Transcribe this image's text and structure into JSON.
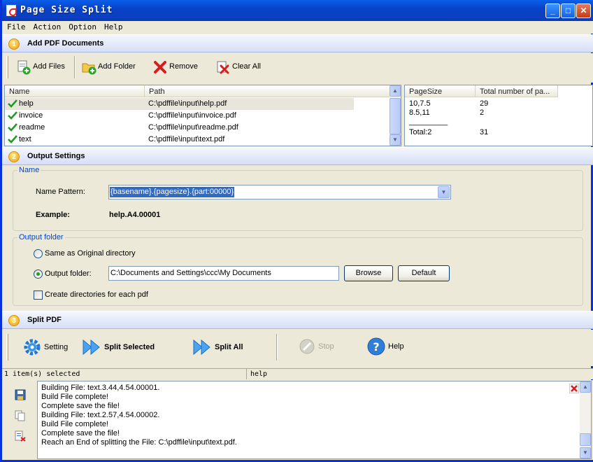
{
  "window": {
    "title": "Page Size Split"
  },
  "menu": [
    "File",
    "Action",
    "Option",
    "Help"
  ],
  "section1": {
    "num": "1",
    "title": "Add PDF Documents"
  },
  "toolbar1": {
    "add_files": "Add Files",
    "add_folder": "Add Folder",
    "remove": "Remove",
    "clear_all": "Clear All"
  },
  "files": {
    "columns": [
      "Name",
      "Path"
    ],
    "rows": [
      {
        "name": "help",
        "path": "C:\\pdffile\\input\\help.pdf"
      },
      {
        "name": "invoice",
        "path": "C:\\pdffile\\input\\invoice.pdf"
      },
      {
        "name": "readme",
        "path": "C:\\pdffile\\input\\readme.pdf"
      },
      {
        "name": "text",
        "path": "C:\\pdffile\\input\\text.pdf"
      }
    ]
  },
  "sizes": {
    "columns": [
      "PageSize",
      "Total number of pa..."
    ],
    "rows": [
      {
        "size": "10,7.5",
        "count": "29"
      },
      {
        "size": "8.5,11",
        "count": "2"
      }
    ],
    "divider": "_________",
    "total_label": "Total:2",
    "total_count": "31"
  },
  "section2": {
    "num": "2",
    "title": "Output Settings"
  },
  "name_group": {
    "legend": "Name",
    "pattern_label": "Name Pattern:",
    "pattern_value": "{basename}.{pagesize}.{part:00000}",
    "example_label": "Example:",
    "example_value": "help.A4.00001"
  },
  "output_group": {
    "legend": "Output folder",
    "same_as_original": "Same as Original directory",
    "output_folder_label": "Output folder:",
    "output_folder_value": "C:\\Documents and Settings\\ccc\\My Documents",
    "browse": "Browse",
    "default": "Default",
    "create_dirs": "Create directories for each pdf"
  },
  "section3": {
    "num": "3",
    "title": "Split PDF"
  },
  "toolbar3": {
    "setting": "Setting",
    "split_selected": "Split Selected",
    "split_all": "Split All",
    "stop": "Stop",
    "help": "Help"
  },
  "status": {
    "selected": "1 item(s) selected",
    "current": "help"
  },
  "log": [
    "Building File: text.3.44,4.54.00001.",
    "Build File complete!",
    "Complete save the file!",
    "Building File: text.2.57,4.54.00002.",
    "Build File complete!",
    "Complete save the file!",
    "Reach an End of splitting the File: C:\\pdffile\\input\\text.pdf."
  ],
  "colors": {
    "title_blue": "#0842c9",
    "accent": "#316ac5",
    "success": "#21a121"
  }
}
